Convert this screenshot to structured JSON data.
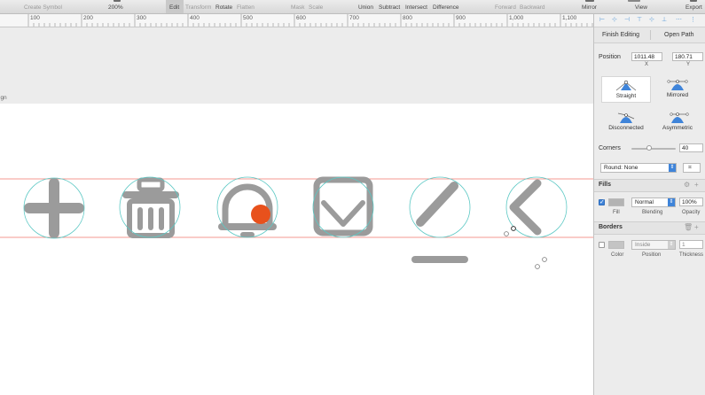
{
  "toolbar": {
    "create_symbol": "Create Symbol",
    "zoom": "200%",
    "edit": "Edit",
    "transform": "Transform",
    "rotate": "Rotate",
    "flatten": "Flatten",
    "mask": "Mask",
    "scale": "Scale",
    "union": "Union",
    "subtract": "Subtract",
    "intersect": "Intersect",
    "difference": "Difference",
    "forward": "Forward",
    "backward": "Backward",
    "mirror": "Mirror",
    "view": "View",
    "export": "Export"
  },
  "ruler": {
    "labels": [
      "100",
      "200",
      "300",
      "400",
      "500",
      "600",
      "700",
      "800",
      "900",
      "1,000",
      "1,100"
    ]
  },
  "canvas": {
    "artboard_label_fragment": "ign",
    "icons": [
      "plus-icon",
      "trash-icon",
      "bell-icon",
      "mail-icon",
      "pencil-icon",
      "chevron-left-icon"
    ],
    "icon_color": "#9b9b9b",
    "guide_circle_color": "#5cc8c4",
    "guide_line_color": "#f0766c",
    "badge_color": "#e8511c"
  },
  "inspector": {
    "finish_editing": "Finish Editing",
    "open_path": "Open Path",
    "position_label": "Position",
    "x_value": "1011.48",
    "y_value": "180.71",
    "x_label": "X",
    "y_label": "Y",
    "point_types": [
      "Straight",
      "Mirrored",
      "Disconnected",
      "Asymmetric"
    ],
    "selected_point_type": "Straight",
    "corners_label": "Corners",
    "corners_value": "40",
    "corners_fraction": 0.4,
    "round_option": "Round: None",
    "fills_title": "Fills",
    "fill_blending": "Normal",
    "fill_opacity": "100%",
    "fill_captions": [
      "Fill",
      "Blending",
      "Opacity"
    ],
    "fill_color": "#b3b3b3",
    "borders_title": "Borders",
    "border_position": "Inside",
    "border_thickness": "1",
    "border_captions": [
      "Color",
      "Position",
      "Thickness"
    ],
    "border_color": "#c4c4c4",
    "accent_color": "#3f84d9"
  }
}
